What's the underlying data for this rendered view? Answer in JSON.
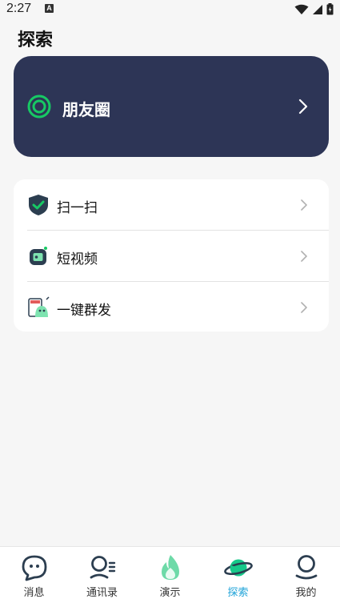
{
  "status_bar": {
    "time": "2:27",
    "notif_letter": "A"
  },
  "page": {
    "title": "探索"
  },
  "moments": {
    "label": "朋友圈"
  },
  "menu": [
    {
      "label": "扫一扫",
      "icon": "shield-check-icon"
    },
    {
      "label": "短视频",
      "icon": "video-camera-icon"
    },
    {
      "label": "一键群发",
      "icon": "broadcast-robot-icon"
    }
  ],
  "tabs": [
    {
      "label": "消息",
      "icon": "chat-bubble-icon",
      "active": false
    },
    {
      "label": "通讯录",
      "icon": "contacts-icon",
      "active": false
    },
    {
      "label": "演示",
      "icon": "flame-icon",
      "active": false
    },
    {
      "label": "探索",
      "icon": "planet-icon",
      "active": true
    },
    {
      "label": "我的",
      "icon": "profile-icon",
      "active": false
    }
  ],
  "colors": {
    "card_dark": "#2d3556",
    "accent_green": "#17c964",
    "active_tab": "#1fa3d8"
  }
}
